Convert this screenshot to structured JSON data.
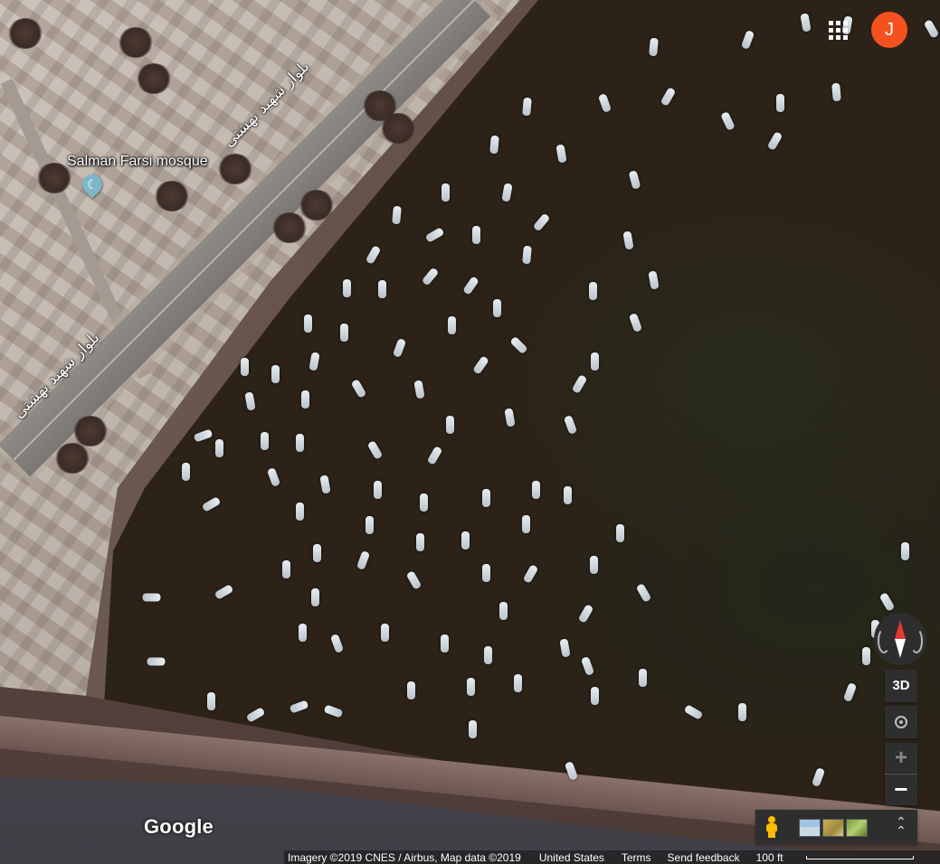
{
  "map": {
    "poi": {
      "name": "Salman Farsi mosque",
      "icon": "mosque-pin-icon"
    },
    "road_labels": [
      "بلوار شهید بهشتی",
      "بلوار شهید بهشتی"
    ]
  },
  "header": {
    "apps_icon": "apps-grid-icon",
    "account_initial": "J",
    "account_color": "#f4511e"
  },
  "controls": {
    "three_d_label": "3D",
    "zoom_in": "+",
    "zoom_out": "−",
    "expand": "⌃"
  },
  "branding": {
    "logo": "Google"
  },
  "footer": {
    "imagery": "Imagery ©2019 CNES / Airbus, Map data ©2019",
    "country": "United States",
    "terms": "Terms",
    "feedback": "Send feedback",
    "scale": "100 ft"
  }
}
